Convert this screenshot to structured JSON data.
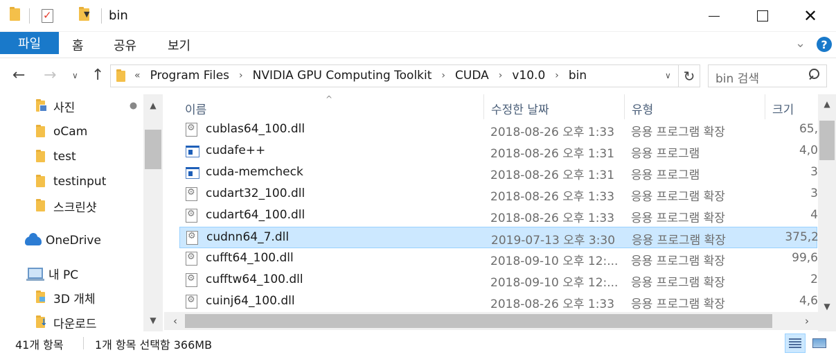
{
  "window": {
    "title": "bin",
    "minimize_label": "",
    "maximize_label": "",
    "close_label": "✕"
  },
  "ribbon": {
    "tabs": [
      "파일",
      "홈",
      "공유",
      "보기"
    ],
    "expand_icon": "chevron-down-icon",
    "help_label": "?"
  },
  "navigation": {
    "back_glyph": "←",
    "forward_glyph": "→",
    "recent_glyph": "∨",
    "up_glyph": "↑",
    "breadcrumb_lead": "«",
    "breadcrumb": [
      "Program Files",
      "NVIDIA GPU Computing Toolkit",
      "CUDA",
      "v10.0",
      "bin"
    ],
    "breadcrumb_separator": "›",
    "refresh_glyph": "↻",
    "search_placeholder": "bin 검색"
  },
  "sidebar": {
    "items": [
      {
        "label": "사진",
        "icon": "pictures-folder-icon",
        "pinned": true
      },
      {
        "label": "oCam",
        "icon": "folder-icon"
      },
      {
        "label": "test",
        "icon": "folder-icon"
      },
      {
        "label": "testinput",
        "icon": "folder-icon"
      },
      {
        "label": "스크린샷",
        "icon": "folder-icon"
      },
      {
        "label": "OneDrive",
        "icon": "onedrive-cloud-icon"
      },
      {
        "label": "내 PC",
        "icon": "computer-icon"
      },
      {
        "label": "3D 개체",
        "icon": "3d-objects-folder-icon"
      },
      {
        "label": "다운로드",
        "icon": "downloads-folder-icon"
      }
    ],
    "pin_glyph": "📌"
  },
  "file_list": {
    "columns": [
      "이름",
      "수정한 날짜",
      "유형",
      "크기"
    ],
    "sort_glyph": "^",
    "rows": [
      {
        "name": "cublas64_100.dll",
        "date": "2018-08-26 오후 1:33",
        "type": "응용 프로그램 확장",
        "size": "65,",
        "icon": "dll-file-icon",
        "selected": false
      },
      {
        "name": "cudafe++",
        "date": "2018-08-26 오후 1:31",
        "type": "응용 프로그램",
        "size": "4,0",
        "icon": "exe-file-icon",
        "selected": false
      },
      {
        "name": "cuda-memcheck",
        "date": "2018-08-26 오후 1:31",
        "type": "응용 프로그램",
        "size": "3",
        "icon": "exe-file-icon",
        "selected": false
      },
      {
        "name": "cudart32_100.dll",
        "date": "2018-08-26 오후 1:33",
        "type": "응용 프로그램 확장",
        "size": "3",
        "icon": "dll-file-icon",
        "selected": false
      },
      {
        "name": "cudart64_100.dll",
        "date": "2018-08-26 오후 1:33",
        "type": "응용 프로그램 확장",
        "size": "4",
        "icon": "dll-file-icon",
        "selected": false
      },
      {
        "name": "cudnn64_7.dll",
        "date": "2019-07-13 오후 3:30",
        "type": "응용 프로그램 확장",
        "size": "375,2",
        "icon": "dll-file-icon",
        "selected": true
      },
      {
        "name": "cufft64_100.dll",
        "date": "2018-09-10 오후 12:...",
        "type": "응용 프로그램 확장",
        "size": "99,6",
        "icon": "dll-file-icon",
        "selected": false
      },
      {
        "name": "cufftw64_100.dll",
        "date": "2018-09-10 오후 12:...",
        "type": "응용 프로그램 확장",
        "size": "2",
        "icon": "dll-file-icon",
        "selected": false
      },
      {
        "name": "cuinj64_100.dll",
        "date": "2018-08-26 오후 1:33",
        "type": "응용 프로그램 확장",
        "size": "4,6",
        "icon": "dll-file-icon",
        "selected": false
      }
    ]
  },
  "status": {
    "item_count": "41개 항목",
    "selection": "1개 항목 선택함 366MB"
  },
  "colors": {
    "accent": "#1979ca",
    "selection_bg": "#cce8ff",
    "selection_border": "#99d1ff",
    "header_text": "#4c607a"
  }
}
